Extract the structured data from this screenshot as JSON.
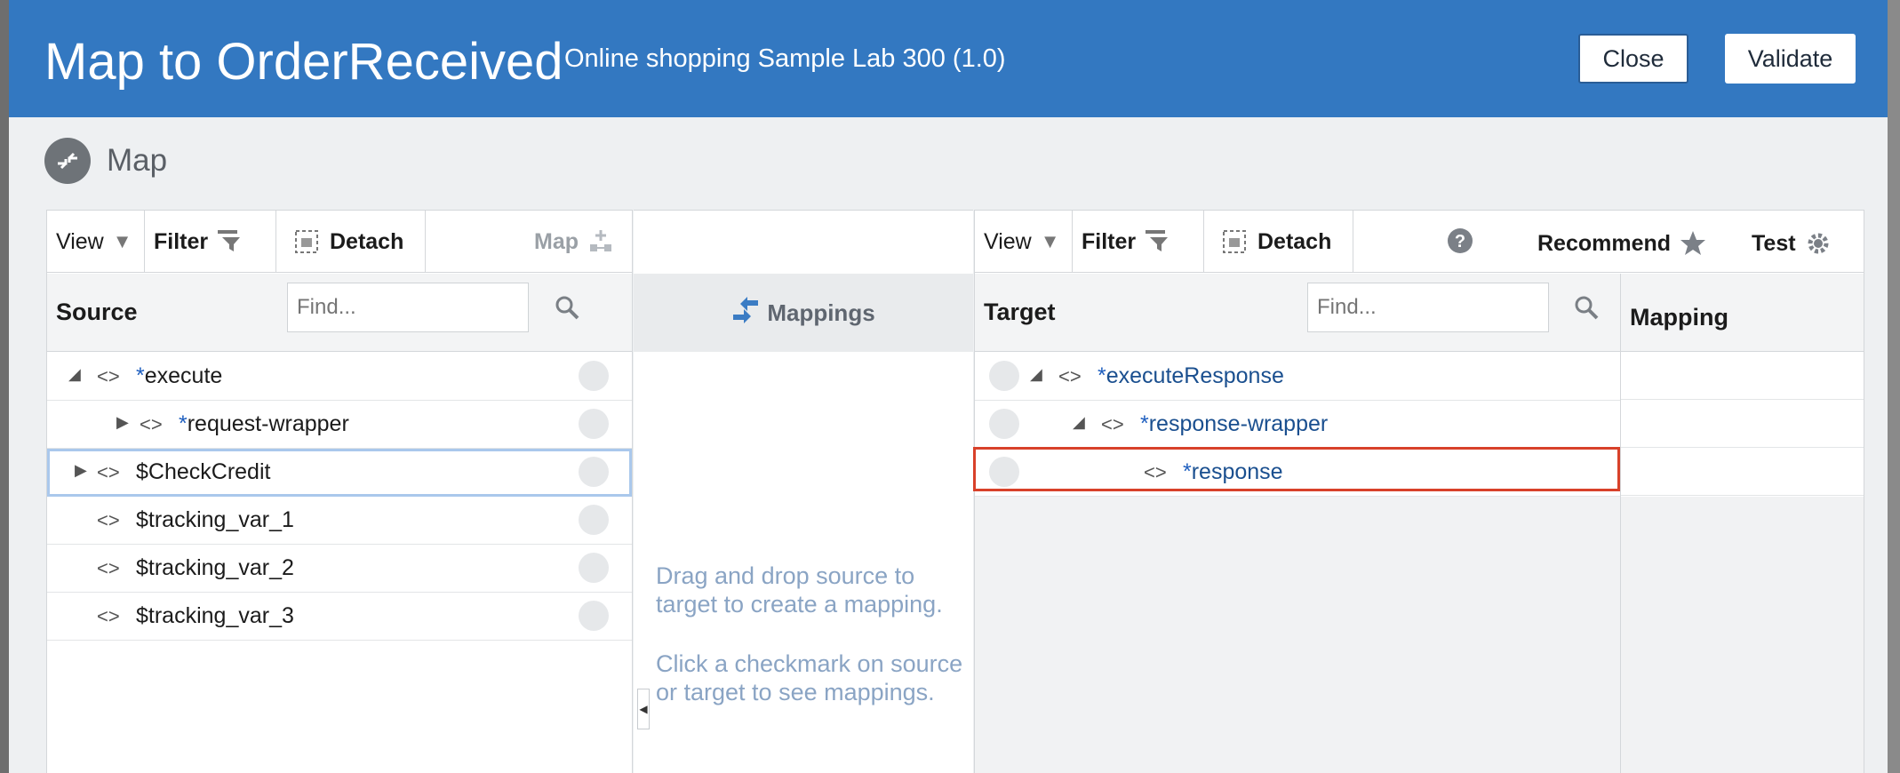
{
  "header": {
    "title": "Map to OrderReceived",
    "subtitle": "Online shopping Sample Lab 300 (1.0)",
    "close_label": "Close",
    "validate_label": "Validate"
  },
  "section": {
    "label": "Map"
  },
  "source_pane": {
    "toolbar": {
      "view": "View",
      "filter": "Filter",
      "detach": "Detach",
      "map": "Map"
    },
    "column_label": "Source",
    "find_placeholder": "Find...",
    "rows": [
      {
        "prefix": "*",
        "label": "execute"
      },
      {
        "prefix": "*",
        "label": "request-wrapper"
      },
      {
        "prefix": "",
        "label": "$CheckCredit"
      },
      {
        "prefix": "",
        "label": "$tracking_var_1"
      },
      {
        "prefix": "",
        "label": "$tracking_var_2"
      },
      {
        "prefix": "",
        "label": "$tracking_var_3"
      }
    ]
  },
  "mappings_pane": {
    "title": "Mappings",
    "hint1": "Drag and drop source to target to create a mapping.",
    "hint2": "Click a checkmark on source or target to see mappings."
  },
  "target_pane": {
    "toolbar": {
      "view": "View",
      "filter": "Filter",
      "detach": "Detach",
      "recommend": "Recommend",
      "test": "Test"
    },
    "column_label": "Target",
    "mapping_column": "Mapping",
    "find_placeholder": "Find...",
    "rows": [
      {
        "prefix": "*",
        "label": "executeResponse"
      },
      {
        "prefix": "*",
        "label": "response-wrapper"
      },
      {
        "prefix": "*",
        "label": "response"
      }
    ]
  },
  "colors": {
    "header_blue": "#3378c1",
    "highlight_red": "#d8412a",
    "link_blue": "#1a4f8f"
  }
}
